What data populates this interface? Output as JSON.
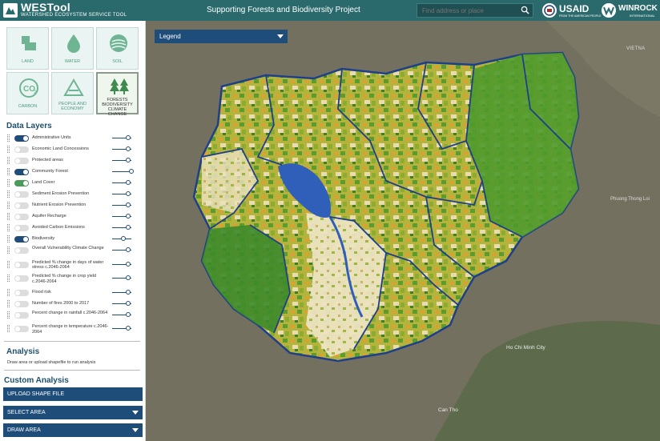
{
  "header": {
    "app_title": "WESTool",
    "app_subtitle": "WATERSHED ECOSYSTEM SERVICE TOOL",
    "project_title": "Supporting Forests and Biodiversity Project",
    "search_placeholder": "Find address or place",
    "usaid_label": "USAID",
    "usaid_sub": "FROM THE AMERICAN PEOPLE",
    "winrock_label": "WINROCK",
    "winrock_sub": "INTERNATIONAL"
  },
  "themes": [
    {
      "label": "LAND",
      "icon": "land-icon"
    },
    {
      "label": "WATER",
      "icon": "water-drop-icon"
    },
    {
      "label": "SOIL",
      "icon": "soil-icon"
    },
    {
      "label": "CARBON",
      "icon": "co2-icon"
    },
    {
      "label": "PEOPLE AND ECONOMY",
      "icon": "triangle-people-icon"
    },
    {
      "label": "FORESTS BIODIVERSITY CLIMATE CHANGE",
      "icon": "trees-icon"
    }
  ],
  "data_layers": {
    "title": "Data Layers",
    "items": [
      {
        "name": "Administrative Units",
        "on": true,
        "slider": 0.85
      },
      {
        "name": "Economic Land Concessions",
        "on": false,
        "slider": 0.85
      },
      {
        "name": "Protected areas",
        "on": false,
        "slider": 0.85
      },
      {
        "name": "Community Forest",
        "on": true,
        "slider": 1.0
      },
      {
        "name": "Land Cover",
        "on": true,
        "slider": 0.85
      },
      {
        "name": "Sediment Erosion Prevention",
        "on": false,
        "slider": 0.85
      },
      {
        "name": "Nutrient Erosion Prevention",
        "on": false,
        "slider": 0.85
      },
      {
        "name": "Aquifer Recharge",
        "on": false,
        "slider": 0.85
      },
      {
        "name": "Avoided Carbon Emissions",
        "on": false,
        "slider": 0.85
      },
      {
        "name": "Biodiversity",
        "on": true,
        "slider": 0.6
      },
      {
        "name": "Overall Vulnerability Climate Change",
        "on": false,
        "slider": 0.85
      },
      {
        "name": "Predicted % change in days of water stress c.2046-2064",
        "on": false,
        "slider": 0.85
      },
      {
        "name": "Predicted % change in crop yield c.2046-2064",
        "on": false,
        "slider": 0.85
      },
      {
        "name": "Flood risk",
        "on": false,
        "slider": 0.85
      },
      {
        "name": "Number of fires 2000 to 2017",
        "on": false,
        "slider": 0.85
      },
      {
        "name": "Percent change in rainfall c.2046-2064",
        "on": false,
        "slider": 0.85
      },
      {
        "name": "Percent change in temperature c.2046-2064",
        "on": false,
        "slider": 0.85
      }
    ]
  },
  "analysis": {
    "title": "Analysis",
    "description": "Draw area or upload shapefile to run analysis"
  },
  "custom_analysis": {
    "title": "Custom Analysis",
    "upload_label": "UPLOAD SHAPE FILE",
    "select_label": "SELECT AREA",
    "draw_label": "DRAW AREA"
  },
  "map": {
    "legend_label": "Legend",
    "places": [
      "VIETNA",
      "Phuong Thong Loi",
      "Ho Chi Minh City",
      "Can Tho"
    ]
  },
  "colors": {
    "header_bg": "#2a6a6c",
    "accent_blue": "#1e4d7a",
    "tile_green": "#4c9a7e"
  }
}
